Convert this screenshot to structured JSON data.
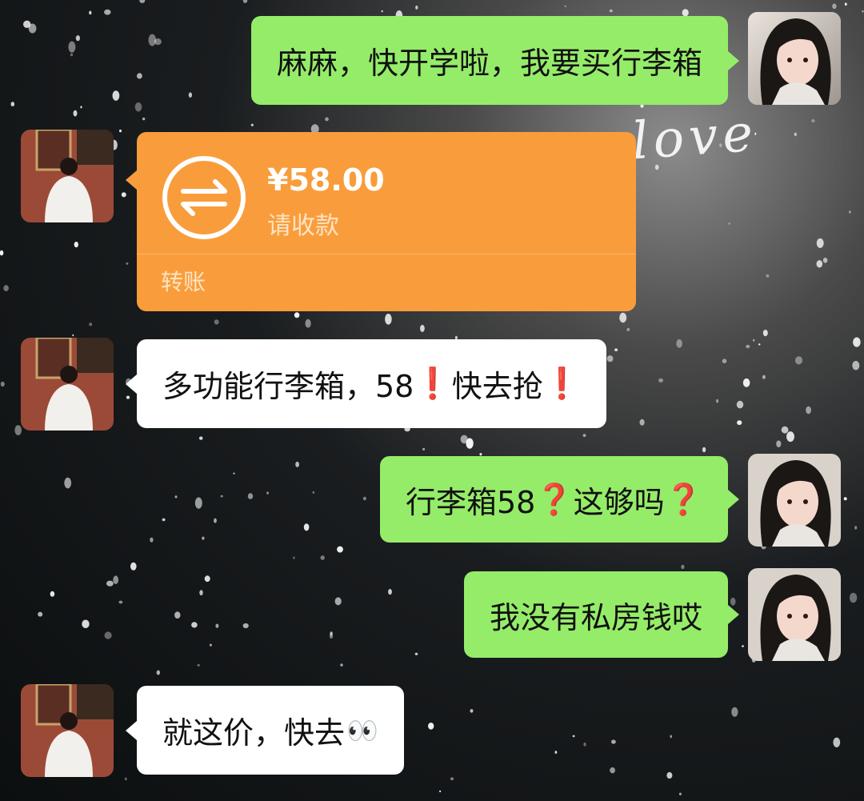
{
  "background": {
    "decor_text": "love"
  },
  "messages": [
    {
      "side": "me",
      "text": "麻麻，快开学啦，我要买行李箱"
    },
    {
      "side": "them",
      "type": "transfer",
      "amount": "¥58.00",
      "status": "请收款",
      "label": "转账"
    },
    {
      "side": "them",
      "parts": [
        "多功能行李箱，58",
        "❗",
        "快去抢",
        "❗"
      ]
    },
    {
      "side": "me",
      "parts": [
        "行李箱58",
        "❓",
        "这够吗",
        "❓"
      ]
    },
    {
      "side": "me",
      "text": "我没有私房钱哎"
    },
    {
      "side": "them",
      "parts": [
        "就这价，快去",
        "👀"
      ]
    }
  ],
  "colors": {
    "me_bubble": "#95ec69",
    "them_bubble": "#ffffff",
    "transfer": "#f99d3c",
    "alert": "#e8302c"
  },
  "icons": {
    "transfer": "transfer-arrows-icon"
  }
}
